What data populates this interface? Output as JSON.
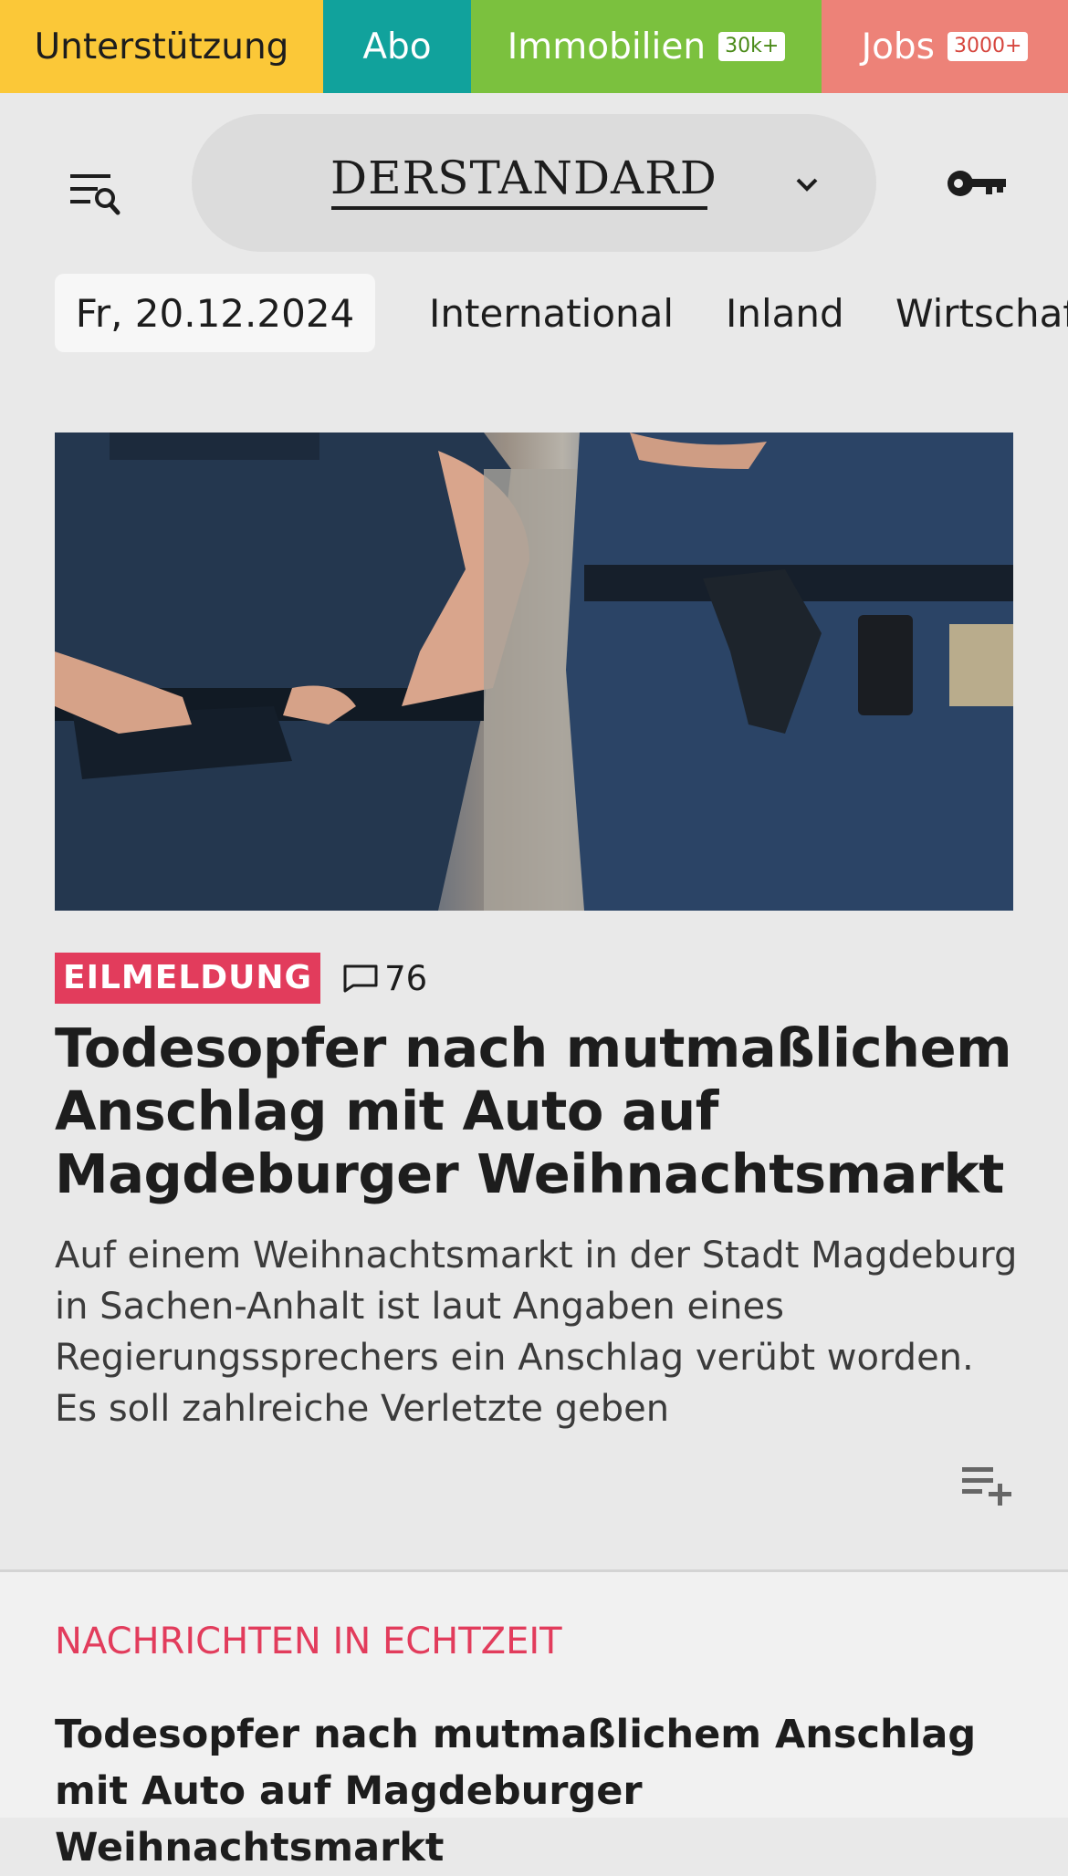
{
  "topbar": {
    "support_label": "Unterstützung",
    "abo_label": "Abo",
    "immo_label": "Immobilien",
    "immo_badge": "30k+",
    "jobs_label": "Jobs",
    "jobs_badge": "3000+",
    "colors": {
      "support": "#fbc838",
      "abo": "#11a29c",
      "immo": "#7bc13e",
      "jobs": "#ed8278"
    }
  },
  "header": {
    "logo_text": "DERSTANDARD",
    "menu_icon": "menu-search-icon",
    "dropdown_icon": "chevron-down-icon",
    "login_icon": "key-icon"
  },
  "nav": {
    "date": "Fr, 20.12.2024",
    "items": [
      "International",
      "Inland",
      "Wirtschaft"
    ]
  },
  "article": {
    "image_alt": "Polizisten mit Einsatzgürteln",
    "badge": "EILMELDUNG",
    "comment_count": "76",
    "headline": "Todesopfer nach mutmaßlichem Anschlag mit Auto auf Magdeburger Weihnachtsmarkt",
    "lead": "Auf einem Weihnachtsmarkt in der Stadt Magdeburg in Sachen-Anhalt ist laut Angaben eines Regierungssprechers ein Anschlag verübt worden. Es soll zahlreiche Verletzte geben",
    "playlist_icon": "playlist-add-icon"
  },
  "live": {
    "label": "NACHRICHTEN IN ECHTZEIT",
    "headline": "Todesopfer nach mutmaßlichem Anschlag mit Auto auf Magdeburger Weihnachtsmarkt"
  },
  "colors": {
    "accent": "#e23c5c",
    "background": "#e9e9e9"
  }
}
